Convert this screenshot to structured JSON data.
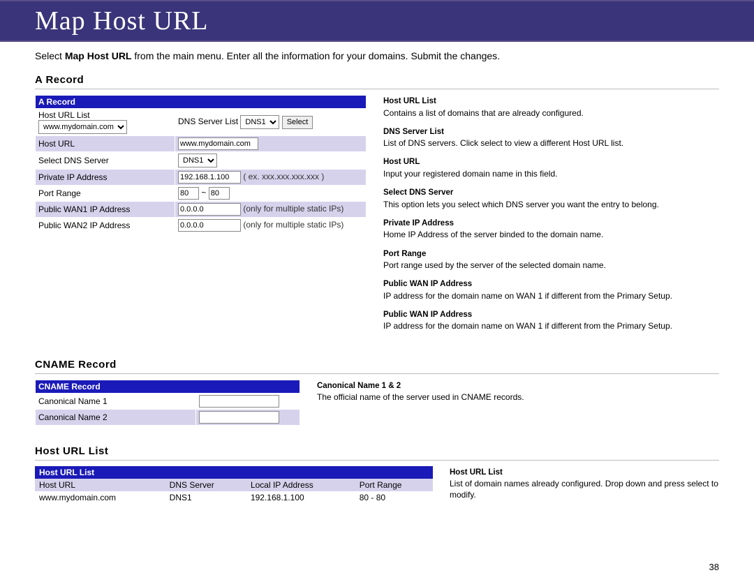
{
  "banner": {
    "title": "Map Host URL"
  },
  "intro": {
    "pre": "Select ",
    "bold": "Map Host URL",
    "post": " from the main menu. Enter all the information for your domains. Submit the changes."
  },
  "a_record": {
    "heading": "A Record",
    "title_row": "A Record",
    "labels": {
      "host_url_list": "Host URL List",
      "dns_server_list": "DNS Server List",
      "host_url": "Host URL",
      "select_dns": "Select DNS Server",
      "private_ip": "Private IP Address",
      "port_range": "Port Range",
      "wan1": "Public WAN1 IP Address",
      "wan2": "Public WAN2 IP Address"
    },
    "values": {
      "host_url_list_sel": "www.mydomain.com",
      "dns_server_list_sel": "DNS1",
      "select_btn": "Select",
      "host_url": "www.mydomain.com",
      "select_dns_sel": "DNS1",
      "private_ip": "192.168.1.100",
      "private_ip_hint": "( ex. xxx.xxx.xxx.xxx )",
      "port_lo": "80",
      "port_sep": "~",
      "port_hi": "80",
      "wan1": "0.0.0.0",
      "wan1_hint": "(only for multiple static IPs)",
      "wan2": "0.0.0.0",
      "wan2_hint": "(only for multiple static IPs)"
    },
    "defs": [
      {
        "term": "Host URL List",
        "text": "Contains a list of domains that are already configured."
      },
      {
        "term": "DNS Server List",
        "text": "List of DNS servers.  Click select to view a different Host URL list."
      },
      {
        "term": "Host URL",
        "text": "Input your registered domain name in this field."
      },
      {
        "term": "Select DNS Server",
        "text": "This option lets you select which DNS server you want the entry to belong."
      },
      {
        "term": "Private IP Address",
        "text": "Home IP Address of the server binded to the domain name."
      },
      {
        "term": "Port Range",
        "text": "Port range used by the server of the selected domain name."
      },
      {
        "term": "Public WAN IP Address",
        "text": "IP address for the domain name on WAN 1 if different  from the Primary Setup."
      },
      {
        "term": "Public WAN IP Address",
        "text": "IP address for the domain name on WAN 1 if different  from the Primary Setup."
      }
    ]
  },
  "cname": {
    "heading": "CNAME Record",
    "title_row": "CNAME Record",
    "row1": "Canonical Name 1",
    "row2": "Canonical Name 2",
    "def_term": "Canonical Name 1 & 2",
    "def_text": "The official name of the server used in CNAME records."
  },
  "host_list": {
    "heading": "Host URL List",
    "title_row": "Host URL List",
    "cols": {
      "c1": "Host URL",
      "c2": "DNS Server",
      "c3": "Local IP Address",
      "c4": "Port Range"
    },
    "rows": [
      {
        "c1": "www.mydomain.com",
        "c2": "DNS1",
        "c3": "192.168.1.100",
        "c4": "80 - 80"
      }
    ],
    "def_term": "Host URL List",
    "def_text": "List of domain names already configured.  Drop down and press select to modify."
  },
  "page_number": "38"
}
